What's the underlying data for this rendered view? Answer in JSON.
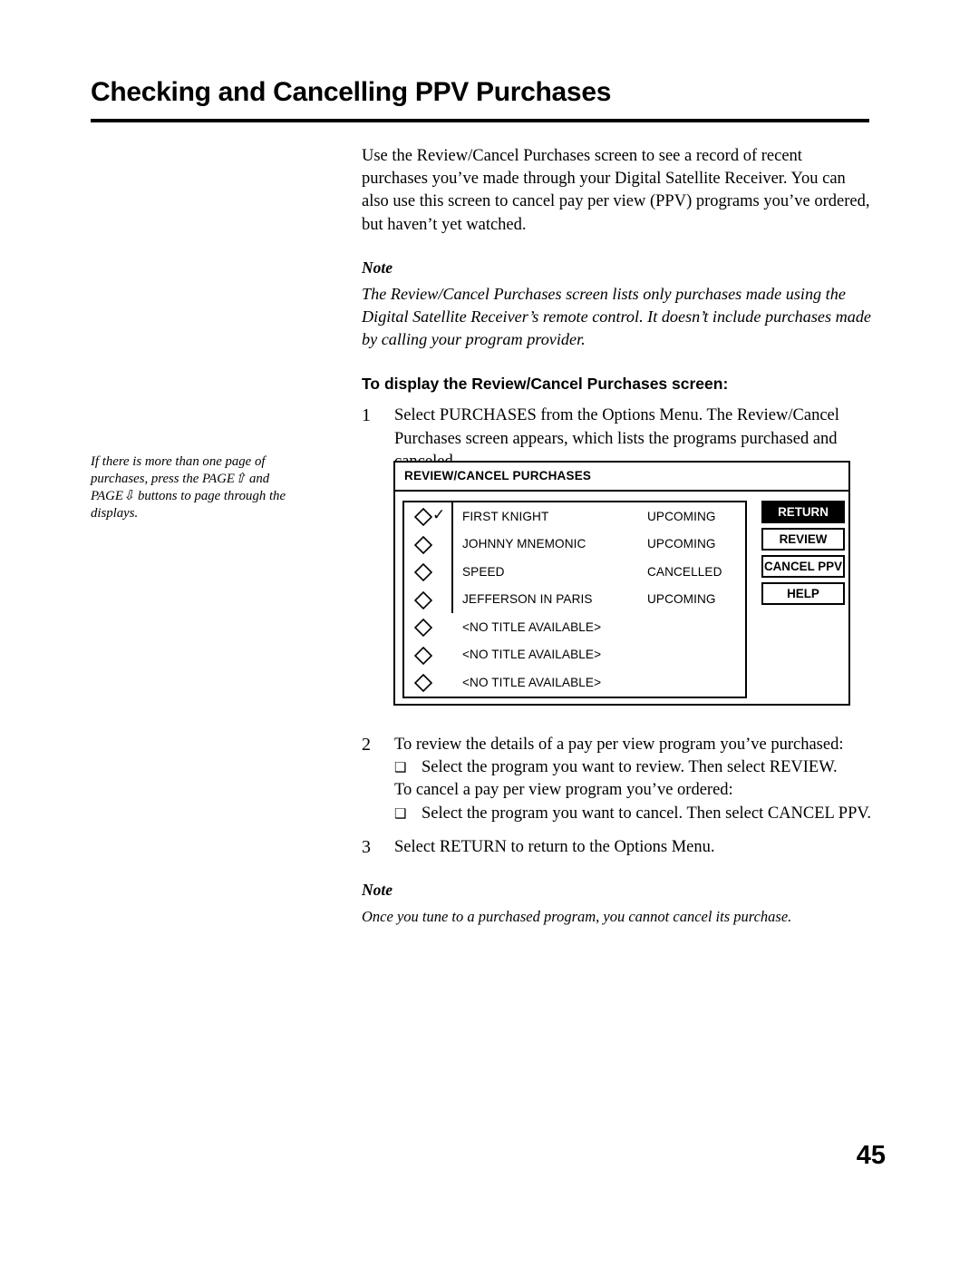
{
  "page": {
    "title": "Checking and Cancelling PPV Purchases",
    "number": "45"
  },
  "intro": {
    "paragraph": "Use the Review/Cancel Purchases screen to see a record of recent purchases you’ve made through your Digital Satellite Receiver. You can also use this screen to cancel pay per view (PPV) programs you’ve ordered, but haven’t yet watched."
  },
  "note1": {
    "label": "Note",
    "text": "The Review/Cancel Purchases screen lists only purchases made using the Digital Satellite Receiver’s remote control. It doesn’t include purchases made by calling your program provider."
  },
  "subhead": "To display the Review/Cancel Purchases screen:",
  "steps": {
    "one": {
      "number": "1",
      "text": "Select PURCHASES from the Options Menu. The Review/Cancel Purchases screen appears, which lists the programs purchased and canceled."
    },
    "two": {
      "number": "2",
      "text": "To review the details of a pay per view program you’ve purchased:",
      "bullet1": "Select the program you want to review. Then select REVIEW.",
      "line2": "To cancel a pay per view program you’ve ordered:",
      "bullet2": "Select the program you want to cancel. Then select CANCEL PPV."
    },
    "three": {
      "number": "3",
      "text": "Select RETURN to return to the Options Menu."
    }
  },
  "note2": {
    "label": "Note",
    "text": "Once you tune to a purchased program, you cannot cancel its purchase."
  },
  "margin_note": {
    "line1": "If there is more than one page of",
    "line2": "purchases, press the PAGE⇧ and",
    "line3": "PAGE⇩ buttons to page through the",
    "line4": "displays."
  },
  "tv_screen": {
    "header": "REVIEW/CANCEL PURCHASES",
    "rows": [
      {
        "title": "FIRST KNIGHT",
        "status": "UPCOMING",
        "checked": true
      },
      {
        "title": "JOHNNY MNEMONIC",
        "status": "UPCOMING",
        "checked": false
      },
      {
        "title": "SPEED",
        "status": "CANCELLED",
        "checked": false
      },
      {
        "title": "JEFFERSON IN PARIS",
        "status": "UPCOMING",
        "checked": false
      },
      {
        "title": "<NO TITLE AVAILABLE>",
        "status": "",
        "checked": false
      },
      {
        "title": "<NO TITLE AVAILABLE>",
        "status": "",
        "checked": false
      },
      {
        "title": "<NO TITLE AVAILABLE>",
        "status": "",
        "checked": false
      }
    ],
    "buttons": [
      {
        "label": "RETURN",
        "selected": true
      },
      {
        "label": "REVIEW",
        "selected": false
      },
      {
        "label": "CANCEL PPV",
        "selected": false
      },
      {
        "label": "HELP",
        "selected": false
      }
    ]
  }
}
